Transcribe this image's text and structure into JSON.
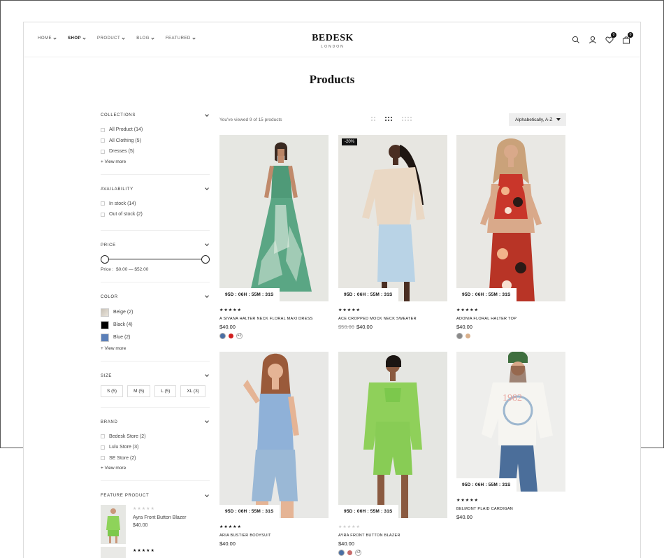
{
  "nav": {
    "items": [
      {
        "label": "HOME"
      },
      {
        "label": "SHOP"
      },
      {
        "label": "PRODUCT"
      },
      {
        "label": "BLOG"
      },
      {
        "label": "FEATURED"
      }
    ]
  },
  "logo": {
    "name": "BEDESK",
    "sub": "LONDON"
  },
  "header": {
    "wishlist_count": "0",
    "cart_count": "0"
  },
  "page": {
    "title": "Products"
  },
  "sidebar": {
    "collections": {
      "title": "COLLECTIONS",
      "items": [
        "All Product (14)",
        "All Clothing (5)",
        "Dresses (5)"
      ],
      "view_more": "+ View more"
    },
    "availability": {
      "title": "AVAILABILITY",
      "items": [
        "In stock (14)",
        "Out of stock (2)"
      ]
    },
    "price": {
      "title": "PRICE",
      "label": "Price :",
      "range": "$0.00 — $52.00"
    },
    "color": {
      "title": "COLOR",
      "items": [
        {
          "label": "Beige (2)",
          "color": "#d8cfc2"
        },
        {
          "label": "Black (4)",
          "color": "#000000"
        },
        {
          "label": "Blue (2)",
          "color": "#5b7fb8"
        }
      ],
      "view_more": "+ View more"
    },
    "size": {
      "title": "SIZE",
      "items": [
        "S (5)",
        "M (5)",
        "L (5)",
        "XL (3)"
      ]
    },
    "brand": {
      "title": "BRAND",
      "items": [
        "Bedesk Store (2)",
        "Lulu Store (3)",
        "SE Store (2)"
      ],
      "view_more": "+ View more"
    },
    "feature": {
      "title": "FEATURE PRODUCT",
      "item": {
        "stars": "★★★★★",
        "name": "Ayra Front Button Blazer",
        "price": "$40.00"
      },
      "item2_stars": "★★★★★"
    }
  },
  "toolbar": {
    "viewed": "You've viewed 9 of 15 products",
    "sort": "Alphabetically, A-Z"
  },
  "products": [
    {
      "name": "A SIVANA HALTER NECK FLORAL MAXI DRESS",
      "price": "$40.00",
      "old_price": "",
      "countdown": "95D : 06H : 55M : 31S",
      "stars": "★★★★★",
      "badge": "",
      "swatches": [
        "#4a6fa5",
        "#d11f1f"
      ],
      "more": "+1",
      "bg": "#e6e7e2"
    },
    {
      "name": "ACE CROPPED MOCK NECK SWEATER",
      "price": "$40.00",
      "old_price": "$50.00",
      "countdown": "95D : 06H : 55M : 31S",
      "stars": "★★★★★",
      "badge": "-20%",
      "swatches": [],
      "more": "",
      "bg": "#e7e6e1"
    },
    {
      "name": "ADONIA FLORAL HALTER TOP",
      "price": "$40.00",
      "old_price": "",
      "countdown": "95D : 06H : 55M : 31S",
      "stars": "★★★★★",
      "badge": "",
      "swatches": [
        "#8a8a8a",
        "#d9b08c"
      ],
      "more": "",
      "bg": "#e9e8e4"
    },
    {
      "name": "ARIA BUSTIER BODYSUIT",
      "price": "$40.00",
      "old_price": "",
      "countdown": "95D : 06H : 55M : 31S",
      "stars": "★★★★★",
      "badge": "",
      "swatches": [],
      "more": "",
      "bg": "#e8e8e6"
    },
    {
      "name": "AYRA FRONT BUTTON BLAZER",
      "price": "$40.00",
      "old_price": "",
      "countdown": "95D : 06H : 55M : 31S",
      "stars": "★★★★★",
      "stars_empty": true,
      "badge": "",
      "swatches": [
        "#4a6fa5",
        "#c76b6b"
      ],
      "more": "+2",
      "bg": "#e5e6e2"
    },
    {
      "name": "BELMONT PLAID CARDIGAN",
      "price": "$40.00",
      "old_price": "",
      "countdown": "95D : 06H : 55M : 31S",
      "stars": "★★★★★",
      "badge": "",
      "swatches": [],
      "more": "",
      "bg": "#eeeeec"
    }
  ]
}
